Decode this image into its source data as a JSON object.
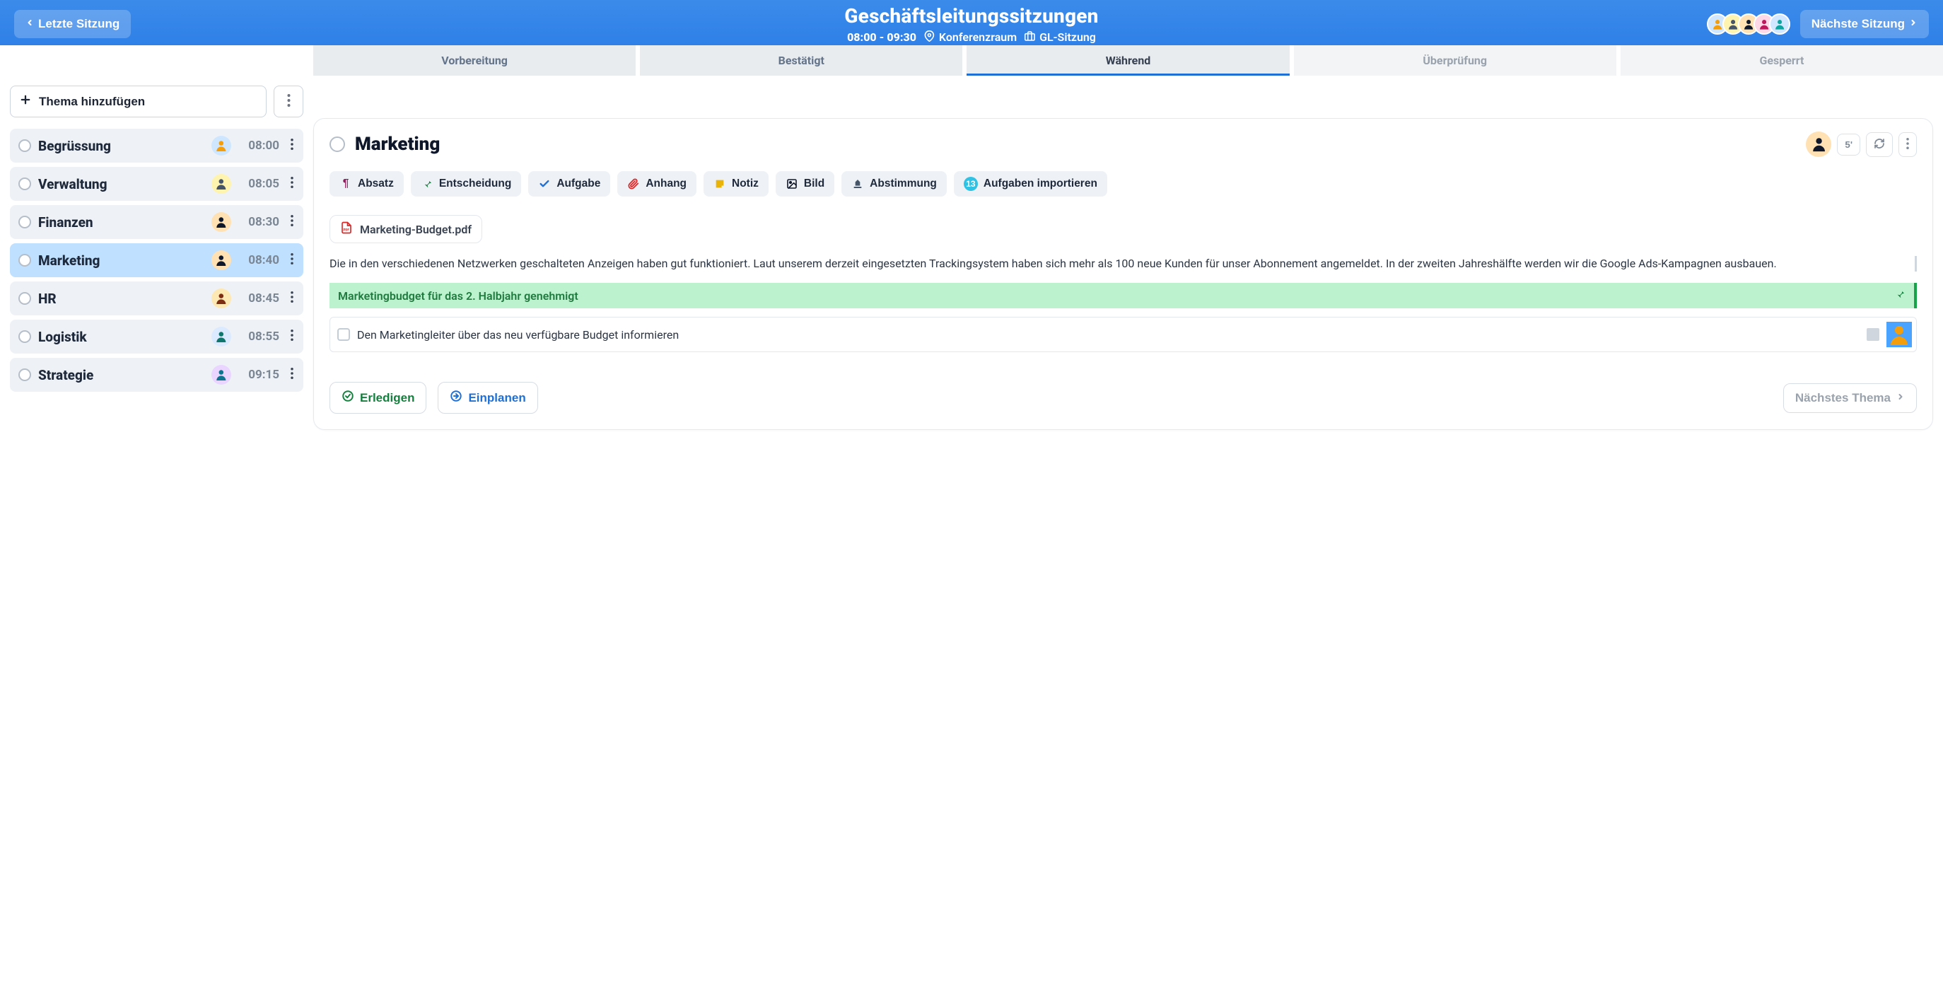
{
  "header": {
    "prev_label": "Letzte Sitzung",
    "next_label": "Nächste Sitzung",
    "title": "Geschäftsleitungssitzungen",
    "time_range": "08:00 - 09:30",
    "room": "Konferenzraum",
    "meeting_type": "GL-Sitzung",
    "avatars": [
      {
        "bg": "#cfe6ff",
        "fg": "#f59e0b"
      },
      {
        "bg": "#fff3b0",
        "fg": "#475569"
      },
      {
        "bg": "#ffe1b3",
        "fg": "#0f172a"
      },
      {
        "bg": "#ffd8e7",
        "fg": "#be185d"
      },
      {
        "bg": "#d1e7ff",
        "fg": "#0ea5a0"
      }
    ]
  },
  "stages": [
    {
      "label": "Vorbereitung",
      "state": "normal"
    },
    {
      "label": "Bestätigt",
      "state": "normal"
    },
    {
      "label": "Während",
      "state": "active"
    },
    {
      "label": "Überprüfung",
      "state": "disabled"
    },
    {
      "label": "Gesperrt",
      "state": "disabled"
    }
  ],
  "sidebar": {
    "add_label": "Thema hinzufügen",
    "items": [
      {
        "label": "Begrüssung",
        "time": "08:00",
        "avatar": {
          "bg": "#cfe6ff",
          "fg": "#f59e0b"
        },
        "selected": false
      },
      {
        "label": "Verwaltung",
        "time": "08:05",
        "avatar": {
          "bg": "#fff3b0",
          "fg": "#475569"
        },
        "selected": false
      },
      {
        "label": "Finanzen",
        "time": "08:30",
        "avatar": {
          "bg": "#ffe1b3",
          "fg": "#0f172a"
        },
        "selected": false
      },
      {
        "label": "Marketing",
        "time": "08:40",
        "avatar": {
          "bg": "#ffe1b3",
          "fg": "#0f172a"
        },
        "selected": true
      },
      {
        "label": "HR",
        "time": "08:45",
        "avatar": {
          "bg": "#fde8b3",
          "fg": "#7c2d12"
        },
        "selected": false
      },
      {
        "label": "Logistik",
        "time": "08:55",
        "avatar": {
          "bg": "#dbeafe",
          "fg": "#0f766e"
        },
        "selected": false
      },
      {
        "label": "Strategie",
        "time": "09:15",
        "avatar": {
          "bg": "#e9d5ff",
          "fg": "#0e7490"
        },
        "selected": false
      }
    ]
  },
  "topic": {
    "title": "Marketing",
    "duration": "5'",
    "presenter_avatar": {
      "bg": "#ffe1b3",
      "fg": "#0f172a"
    },
    "toolbar": {
      "absatz": "Absatz",
      "entscheidung": "Entscheidung",
      "aufgabe": "Aufgabe",
      "anhang": "Anhang",
      "notiz": "Notiz",
      "bild": "Bild",
      "abstimmung": "Abstimmung",
      "import": "Aufgaben importieren",
      "import_count": "13"
    },
    "attachment": "Marketing-Budget.pdf",
    "paragraph": "Die in den verschiedenen Netzwerken geschalteten Anzeigen haben gut funktioniert. Laut unserem derzeit eingesetzten Trackingsystem haben sich mehr als 100 neue Kunden für unser Abonnement angemeldet. In der zweiten Jahreshälfte werden wir die Google Ads-Kampagnen ausbauen.",
    "decision": "Marketingbudget für das 2. Halbjahr genehmigt",
    "task": "Den Marketingleiter über das neu verfügbare Budget informieren",
    "task_assignee": {
      "bg": "#4aa3ff",
      "fg": "#f59e0b"
    },
    "footer": {
      "done": "Erledigen",
      "plan": "Einplanen",
      "next": "Nächstes Thema"
    }
  }
}
